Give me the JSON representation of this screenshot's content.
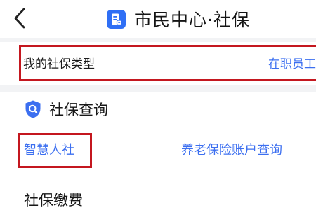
{
  "header": {
    "back_icon": "chevron-left-icon",
    "logo_icon": "citizen-center-logo-icon",
    "title": "市民中心·社保"
  },
  "social_security_type": {
    "label": "我的社保类型",
    "value": "在职员工"
  },
  "query_section": {
    "icon": "shield-icon",
    "title": "社保查询",
    "links": [
      {
        "label": "智慧人社"
      },
      {
        "label": "养老保险账户查询"
      }
    ]
  },
  "payment_section": {
    "title": "社保缴费"
  },
  "colors": {
    "accent": "#3c6ff0",
    "logo_blue": "#2f6ff5",
    "highlight_red": "#c4171f",
    "background_grey": "#f2f3f5"
  }
}
